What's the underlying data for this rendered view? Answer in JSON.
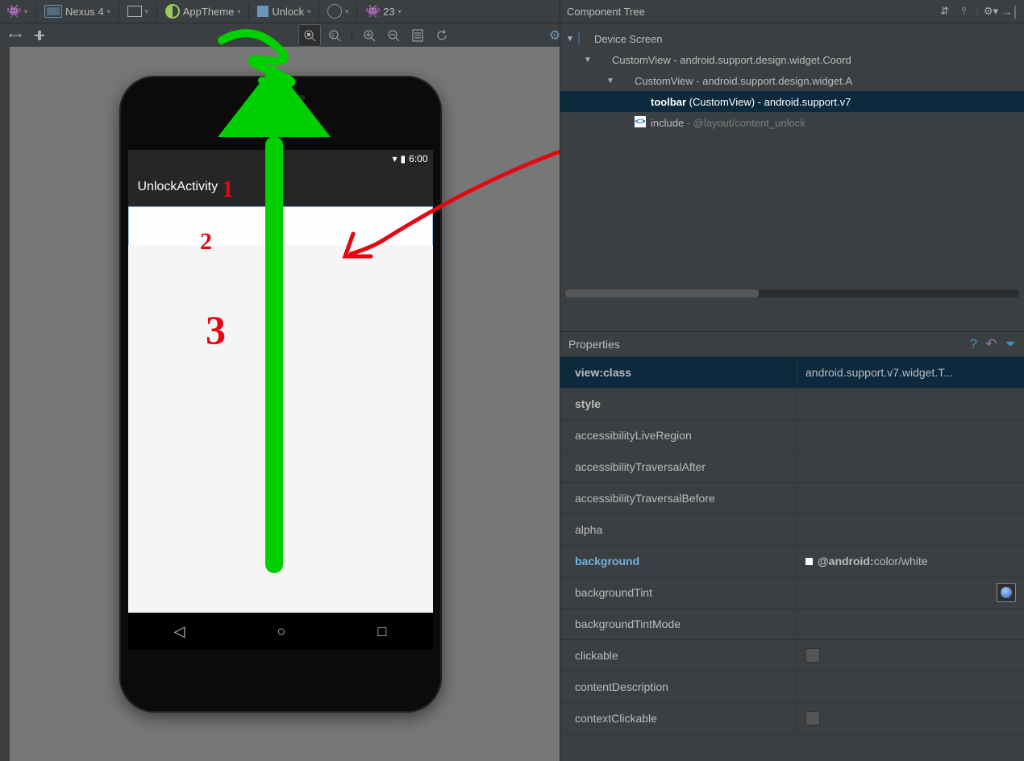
{
  "toolbar": {
    "device": "Nexus 4",
    "theme": "AppTheme",
    "layout": "Unlock",
    "api": "23"
  },
  "device_preview": {
    "clock": "6:00",
    "appbar_title": "UnlockActivity"
  },
  "annotations": {
    "n1": "1",
    "n2": "2",
    "n3": "3"
  },
  "component_tree": {
    "title": "Component Tree",
    "root": "Device Screen",
    "node1": "CustomView - android.support.design.widget.Coord",
    "node2": "CustomView - android.support.design.widget.A",
    "node3_bold": "toolbar",
    "node3_rest": " (CustomView) - android.support.v7",
    "node4_a": "include",
    "node4_b": " - @layout/content_unlock"
  },
  "properties": {
    "title": "Properties",
    "rows": {
      "viewclass": {
        "name": "view:class",
        "value": "android.support.v7.widget.T..."
      },
      "style": {
        "name": "style",
        "value": ""
      },
      "alr": {
        "name": "accessibilityLiveRegion",
        "value": ""
      },
      "ata": {
        "name": "accessibilityTraversalAfter",
        "value": ""
      },
      "atb": {
        "name": "accessibilityTraversalBefore",
        "value": ""
      },
      "alpha": {
        "name": "alpha",
        "value": ""
      },
      "background": {
        "name": "background",
        "value_prefix": "@android:",
        "value_rest": "color/white"
      },
      "backgroundTint": {
        "name": "backgroundTint",
        "value": ""
      },
      "backgroundTintMode": {
        "name": "backgroundTintMode",
        "value": ""
      },
      "clickable": {
        "name": "clickable",
        "value": ""
      },
      "contentDescription": {
        "name": "contentDescription",
        "value": ""
      },
      "contextClickable": {
        "name": "contextClickable",
        "value": ""
      }
    }
  }
}
